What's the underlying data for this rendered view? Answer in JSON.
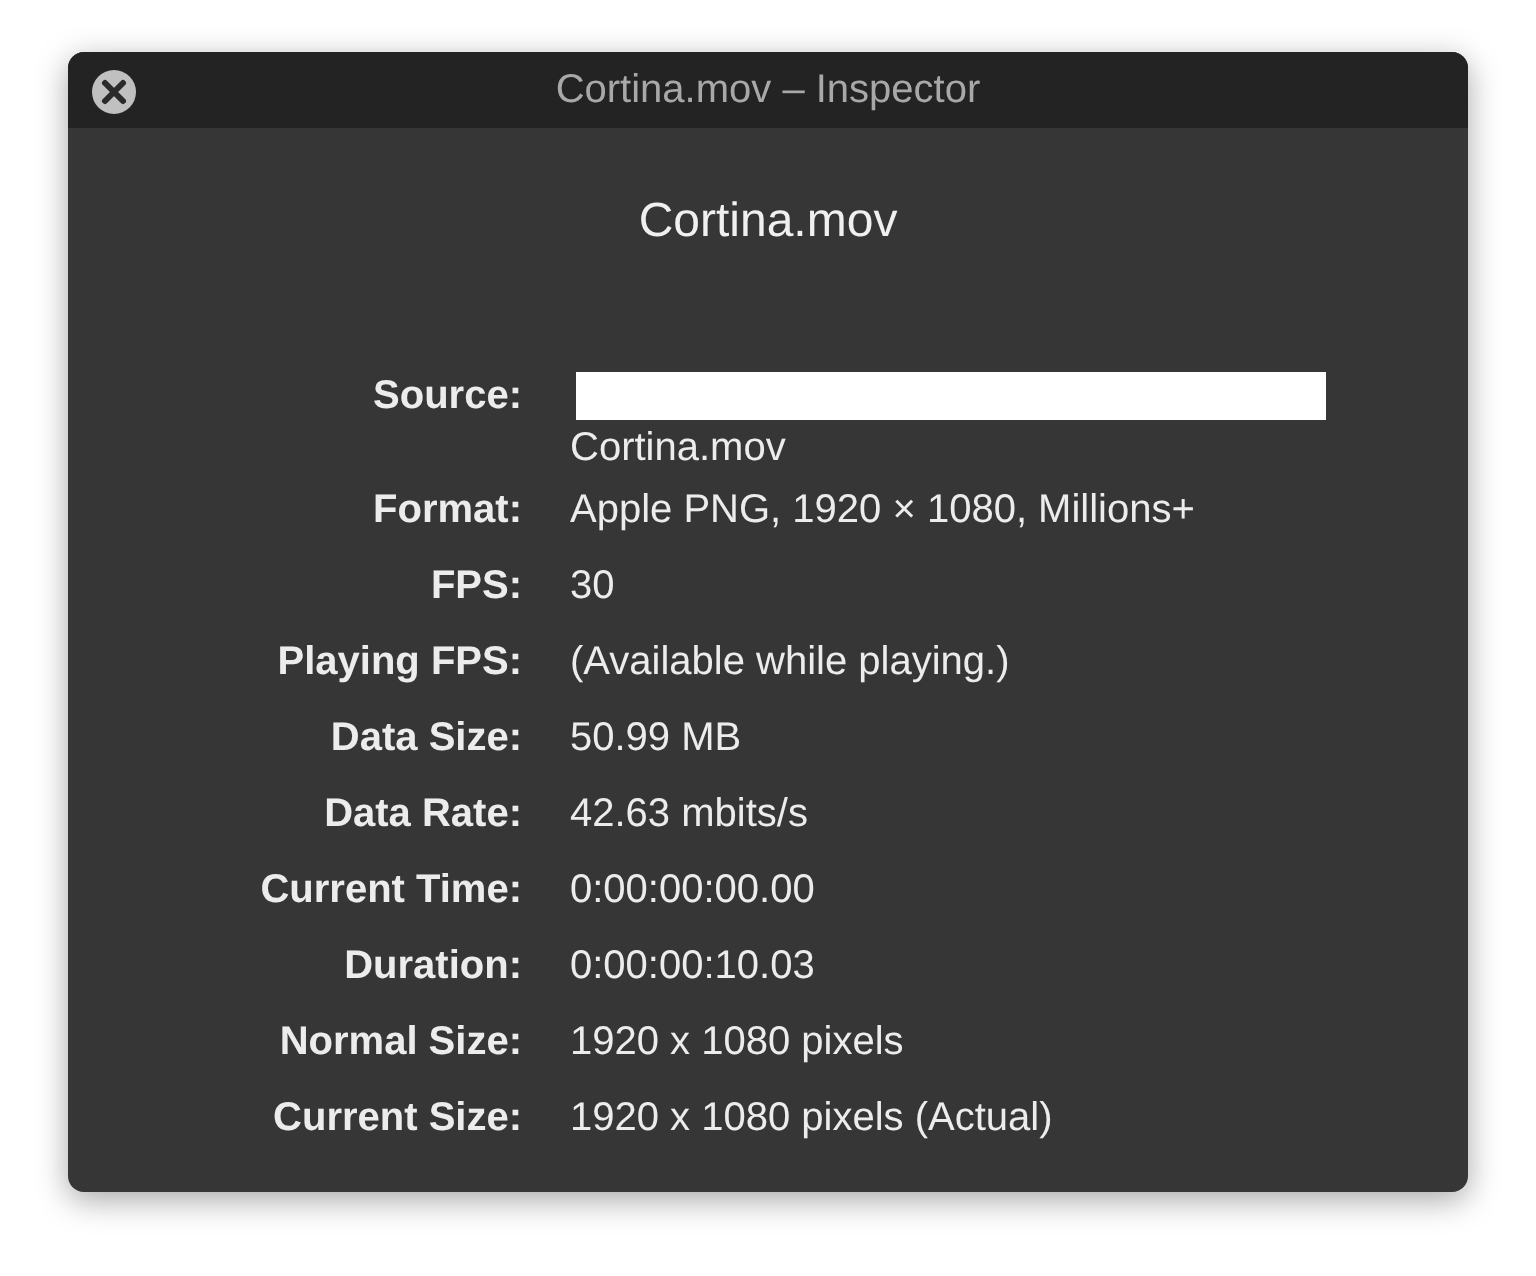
{
  "window": {
    "title": "Cortina.mov – Inspector"
  },
  "heading": "Cortina.mov",
  "fields": [
    {
      "label": "Source:",
      "value": "Cortina.mov",
      "kind": "redacted"
    },
    {
      "label": "Format:",
      "value": "Apple PNG, 1920 × 1080, Millions+",
      "kind": "plain"
    },
    {
      "label": "FPS:",
      "value": "30",
      "kind": "plain"
    },
    {
      "label": "Playing FPS:",
      "value": "(Available while playing.)",
      "kind": "plain"
    },
    {
      "label": "Data Size:",
      "value": "50.99 MB",
      "kind": "plain"
    },
    {
      "label": "Data Rate:",
      "value": "42.63 mbits/s",
      "kind": "plain"
    },
    {
      "label": "Current Time:",
      "value": "0:00:00:00.00",
      "kind": "plain"
    },
    {
      "label": "Duration:",
      "value": "0:00:00:10.03",
      "kind": "plain"
    },
    {
      "label": "Normal Size:",
      "value": "1920 x 1080 pixels",
      "kind": "plain"
    },
    {
      "label": "Current Size:",
      "value": "1920 x 1080 pixels (Actual)",
      "kind": "plain"
    }
  ]
}
